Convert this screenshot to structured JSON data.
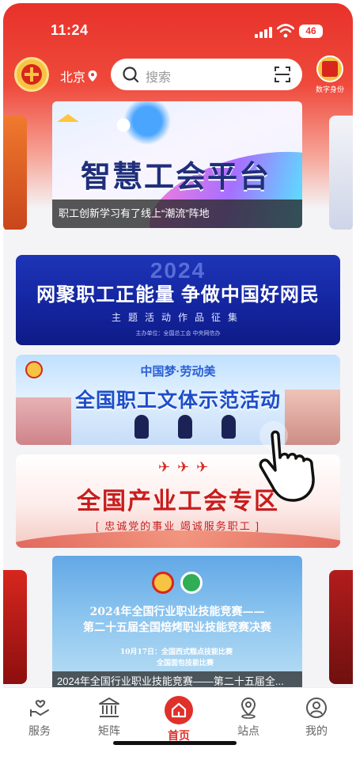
{
  "status_bar": {
    "time": "11:24",
    "battery": "46"
  },
  "top_bar": {
    "city": "北京",
    "search_placeholder": "搜索",
    "digital_id_label": "数字身份"
  },
  "carousel_top": {
    "title": "智慧工会平台",
    "caption": "职工创新学习有了线上“潮流”阵地"
  },
  "banners": [
    {
      "year": "2024",
      "title": "网聚职工正能量  争做中国好网民",
      "subtitle": "主题活动作品征集",
      "organizer": "主办单位：全国总工会   中央网信办"
    },
    {
      "subtitle": "中国梦·劳动美",
      "title": "全国职工文体示范活动"
    },
    {
      "title": "全国产业工会专区",
      "slogan": "[ 忠诚党的事业  竭诚服务职工 ]"
    }
  ],
  "carousel_bottom": {
    "line1": "2024年全国行业职业技能竞赛——",
    "line2": "第二十五届全国焙烤职业技能竞赛决赛",
    "event1": "10月17日：全国西式糕点技能比赛",
    "event2": "全国面包技能比赛",
    "caption": "2024年全国行业职业技能竞赛——第二十五届全..."
  },
  "tabs": [
    {
      "label": "服务"
    },
    {
      "label": "矩阵"
    },
    {
      "label": "首页"
    },
    {
      "label": "站点"
    },
    {
      "label": "我的"
    }
  ],
  "colors": {
    "accent": "#e0302a",
    "header": "#e8322a"
  }
}
